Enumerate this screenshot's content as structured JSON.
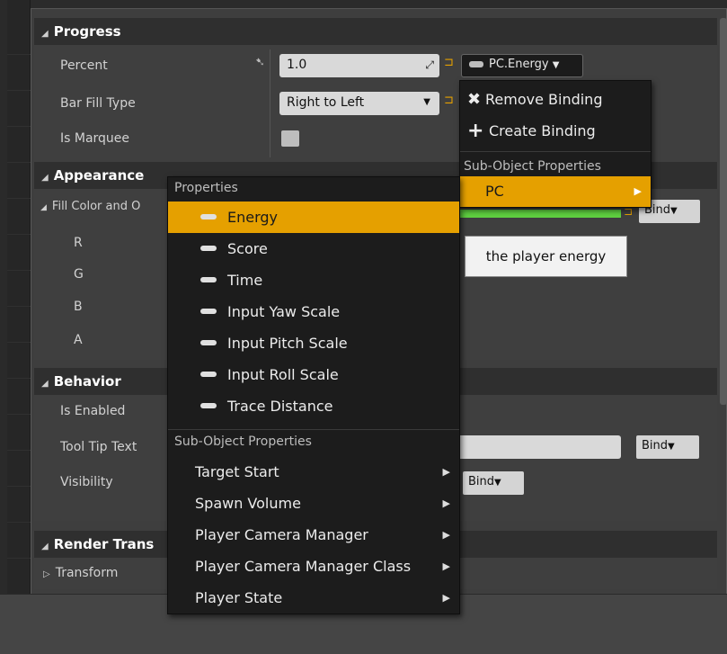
{
  "progress": {
    "header": "Progress",
    "rows": [
      {
        "label": "Percent",
        "value": "1.0"
      },
      {
        "label": "Bar Fill Type",
        "value": "Right to Left"
      },
      {
        "label": "Is Marquee"
      }
    ],
    "binding_label": "PC.Energy"
  },
  "binding_menu": {
    "remove": "Remove Binding",
    "create": "Create Binding",
    "subheader": "Sub-Object Properties",
    "pc_item": "PC"
  },
  "appearance": {
    "header": "Appearance",
    "fill_label": "Fill Color and O",
    "channels": [
      "R",
      "G",
      "B",
      "A"
    ],
    "bind_label": "Bind"
  },
  "tooltip": "the player energy",
  "behavior": {
    "header": "Behavior",
    "rows": [
      "Is Enabled",
      "Tool Tip Text",
      "Visibility"
    ],
    "bind_label": "Bind",
    "visibility_bind_label": "Bind"
  },
  "render": {
    "header": "Render Trans",
    "transform": "Transform"
  },
  "properties_menu": {
    "header": "Properties",
    "items": [
      "Energy",
      "Score",
      "Time",
      "Input Yaw Scale",
      "Input Pitch Scale",
      "Input Roll Scale",
      "Trace Distance"
    ],
    "sub_header": "Sub-Object Properties",
    "sub_items": [
      "Target Start",
      "Spawn Volume",
      "Player Camera Manager",
      "Player Camera Manager Class",
      "Player State"
    ]
  },
  "colors": {
    "accent": "#e5a000",
    "fill_bar": "#5fd040"
  }
}
